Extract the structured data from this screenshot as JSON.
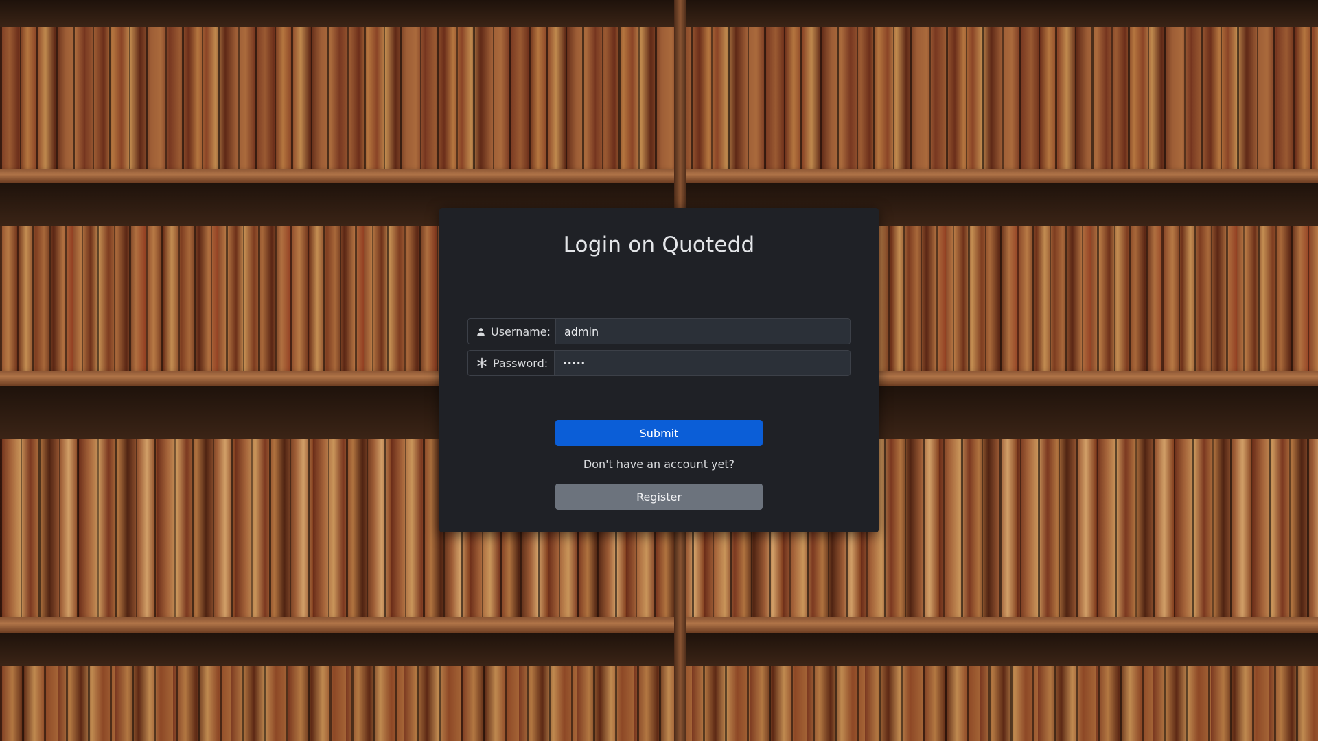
{
  "login": {
    "title": "Login on Quotedd",
    "username": {
      "icon": "person-icon",
      "label": "Username:",
      "value": "admin"
    },
    "password": {
      "icon": "asterisk-icon",
      "label": "Password:",
      "value": "•••••"
    },
    "submit_label": "Submit",
    "account_prompt": "Don't have an account yet?",
    "register_label": "Register"
  },
  "colors": {
    "card_background": "#1f2126",
    "input_background": "#2b3038",
    "submit_button": "#0b5ed7",
    "register_button": "#6c737d",
    "text": "#e3e5e8"
  }
}
